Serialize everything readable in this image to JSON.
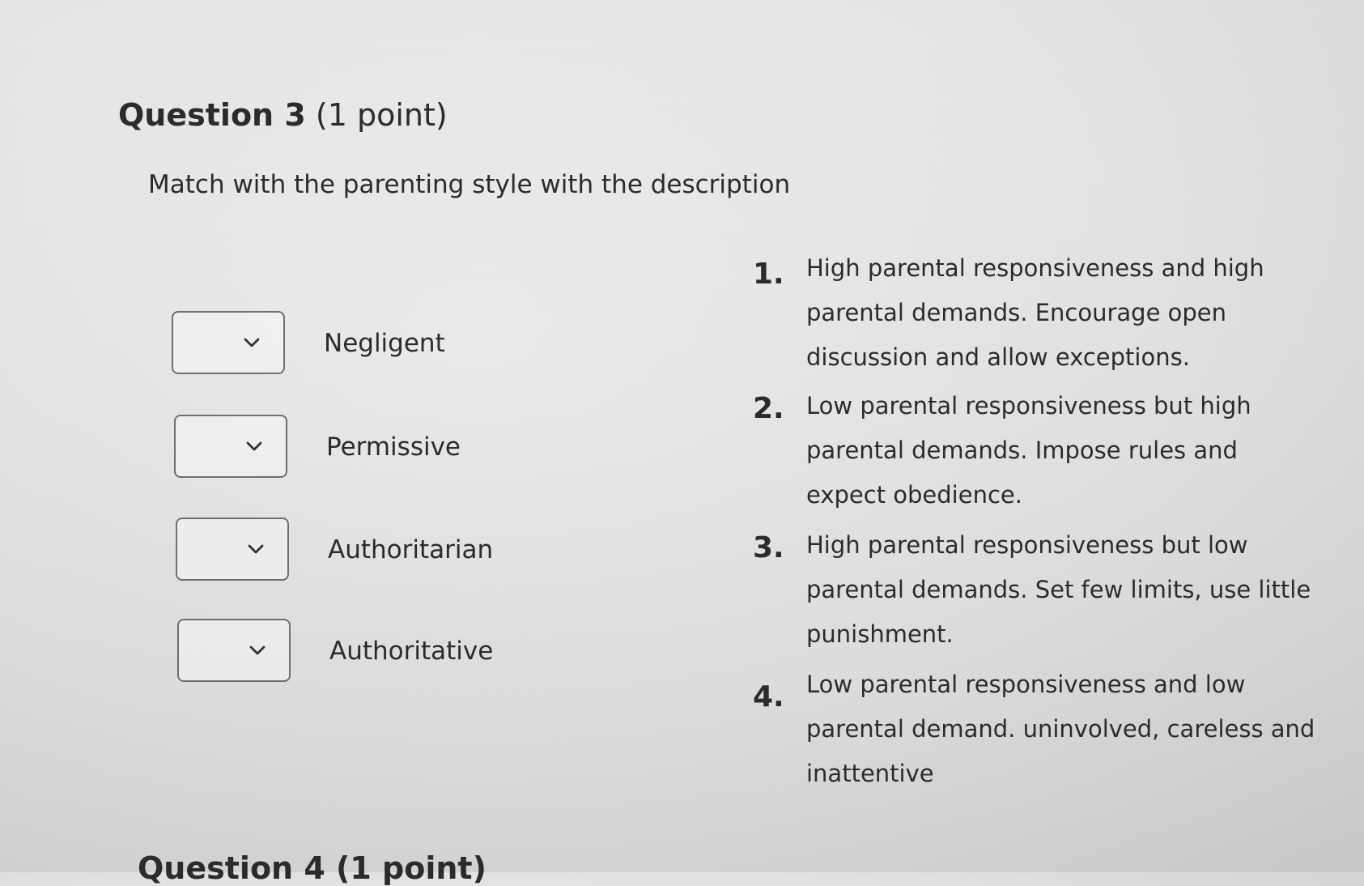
{
  "question": {
    "title": "Question 3",
    "points": "(1 point)",
    "instruction": "Match with the parenting style with the description"
  },
  "matches": [
    {
      "label": "Negligent",
      "selected": ""
    },
    {
      "label": "Permissive",
      "selected": ""
    },
    {
      "label": "Authoritarian",
      "selected": ""
    },
    {
      "label": "Authoritative",
      "selected": ""
    }
  ],
  "descriptions": [
    {
      "number": "1.",
      "text": "High parental responsiveness and high parental demands. Encourage open discussion and allow exceptions."
    },
    {
      "number": "2.",
      "text": "Low parental responsiveness but high parental demands. Impose rules and expect obedience."
    },
    {
      "number": "3.",
      "text": "High parental responsiveness but low parental demands. Set few limits, use little punishment."
    },
    {
      "number": "4.",
      "text": "Low parental responsiveness and low parental demand. uninvolved, careless and inattentive"
    }
  ],
  "next_question": {
    "title": "Question 4 (1 point)"
  },
  "icons": {
    "dropdown": "chevron-down-icon"
  }
}
